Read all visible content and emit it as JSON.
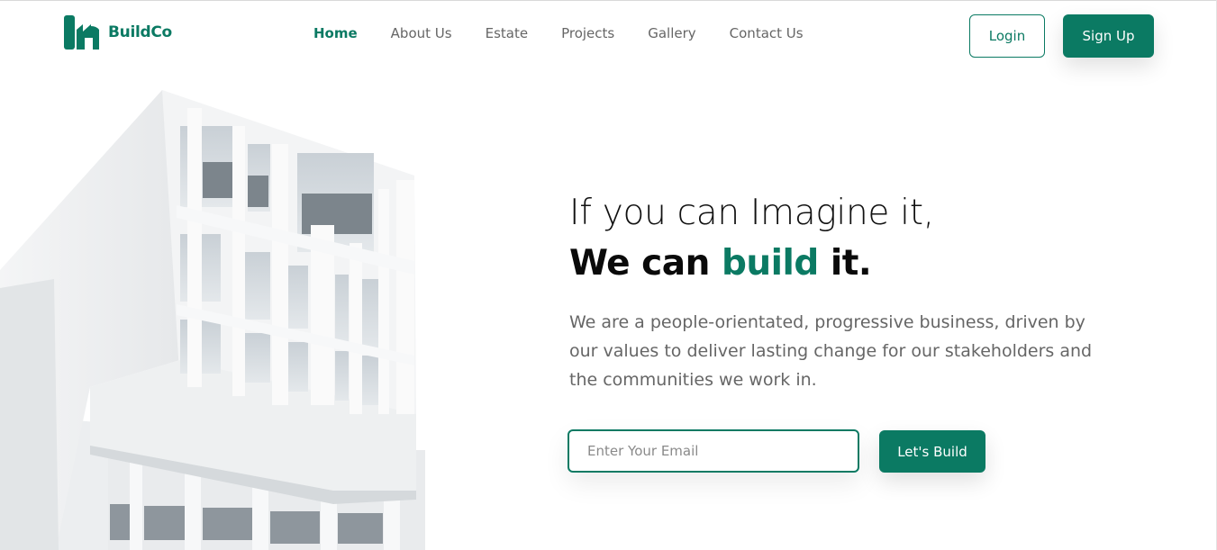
{
  "brand": {
    "name": "BuildCo",
    "logo_icon": "building-logo-icon",
    "color": "#0b7a63"
  },
  "nav": {
    "items": [
      {
        "label": "Home",
        "active": true
      },
      {
        "label": "About Us",
        "active": false
      },
      {
        "label": "Estate",
        "active": false
      },
      {
        "label": "Projects",
        "active": false
      },
      {
        "label": "Gallery",
        "active": false
      },
      {
        "label": "Contact Us",
        "active": false
      }
    ]
  },
  "auth": {
    "login_label": "Login",
    "signup_label": "Sign Up"
  },
  "hero": {
    "headline_line1": "If you can Imagine it,",
    "headline_line2_pre": "We can ",
    "headline_line2_accent": "build",
    "headline_line2_post": " it.",
    "description": "We are a people-orientated, progressive business, driven by our values to deliver lasting change for our stakeholders and the communities we work in.",
    "email_placeholder": "Enter Your Email",
    "email_value": "",
    "cta_label": "Let's Build"
  },
  "colors": {
    "accent": "#0b7a63",
    "text_muted": "#666666"
  }
}
